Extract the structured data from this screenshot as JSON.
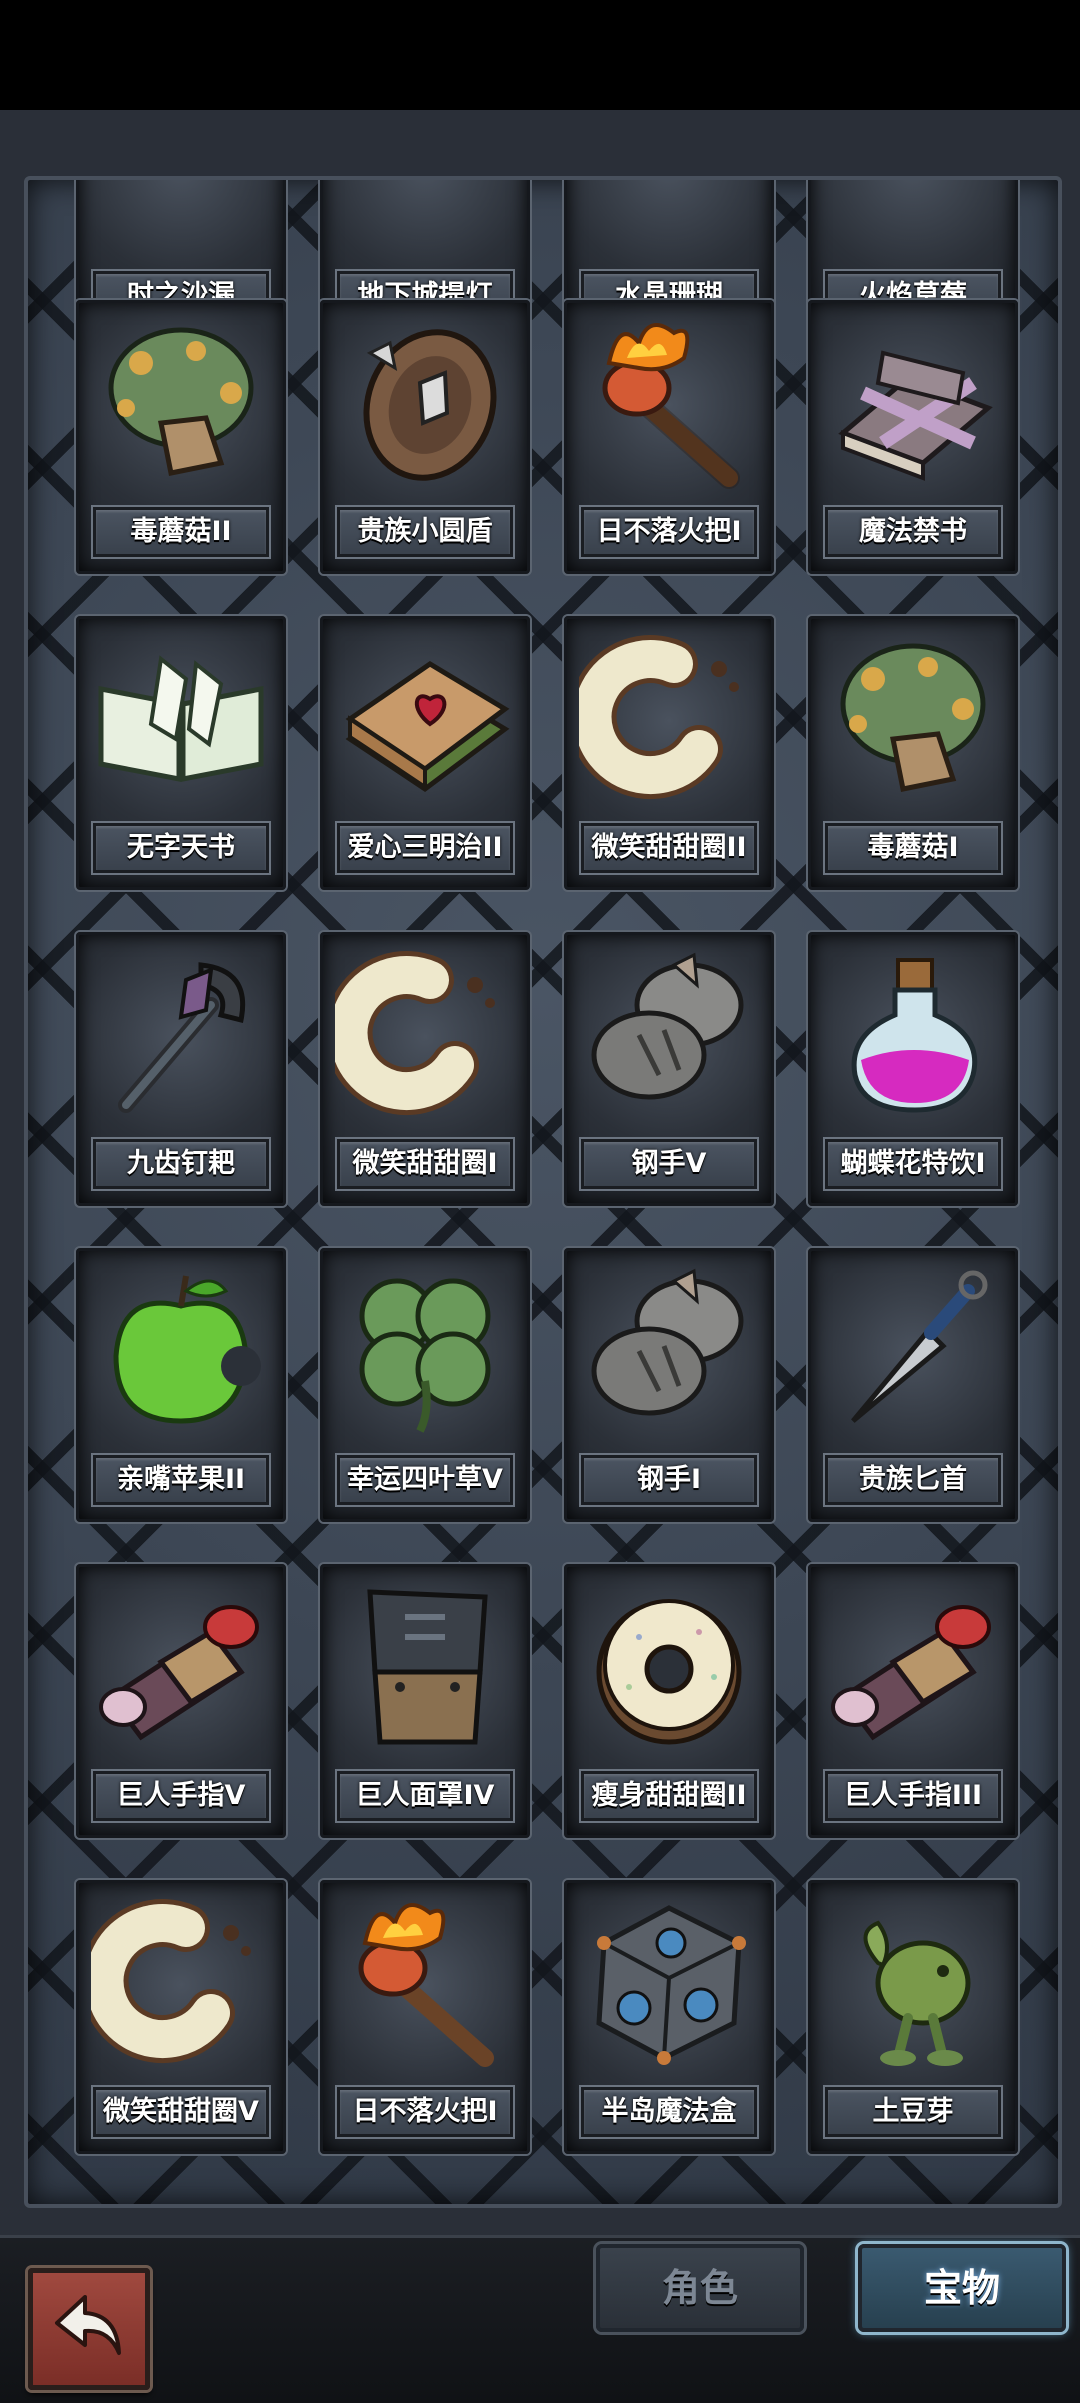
{
  "top_row": [
    "时之沙漏",
    "地下城提灯",
    "水晶珊瑚",
    "火焰草莓"
  ],
  "items": [
    {
      "label": "毒蘑菇II",
      "icon": "poison-mushroom-icon"
    },
    {
      "label": "贵族小圆盾",
      "icon": "round-shield-icon"
    },
    {
      "label": "日不落火把I",
      "icon": "torch-icon"
    },
    {
      "label": "魔法禁书",
      "icon": "forbidden-book-icon"
    },
    {
      "label": "无字天书",
      "icon": "blank-book-icon"
    },
    {
      "label": "爱心三明治II",
      "icon": "heart-sandwich-icon"
    },
    {
      "label": "微笑甜甜圈II",
      "icon": "smile-donut-icon"
    },
    {
      "label": "毒蘑菇I",
      "icon": "poison-mushroom-icon"
    },
    {
      "label": "九齿钉耙",
      "icon": "rake-icon"
    },
    {
      "label": "微笑甜甜圈I",
      "icon": "smile-donut-icon"
    },
    {
      "label": "钢手V",
      "icon": "steel-gauntlet-icon"
    },
    {
      "label": "蝴蝶花特饮I",
      "icon": "potion-bottle-icon"
    },
    {
      "label": "亲嘴苹果II",
      "icon": "bitten-apple-icon"
    },
    {
      "label": "幸运四叶草V",
      "icon": "four-leaf-clover-icon"
    },
    {
      "label": "钢手I",
      "icon": "steel-gauntlet-icon"
    },
    {
      "label": "贵族匕首",
      "icon": "dagger-icon"
    },
    {
      "label": "巨人手指V",
      "icon": "giant-finger-icon"
    },
    {
      "label": "巨人面罩IV",
      "icon": "giant-mask-icon"
    },
    {
      "label": "瘦身甜甜圈II",
      "icon": "sprinkle-donut-icon"
    },
    {
      "label": "巨人手指III",
      "icon": "giant-finger-icon"
    },
    {
      "label": "微笑甜甜圈V",
      "icon": "smile-donut-icon"
    },
    {
      "label": "日不落火把I",
      "icon": "torch-icon"
    },
    {
      "label": "半岛魔法盒",
      "icon": "magic-cube-icon"
    },
    {
      "label": "土豆芽",
      "icon": "potato-sprout-icon"
    }
  ],
  "tabs": {
    "role": "角色",
    "treasure": "宝物"
  },
  "back_icon": "back-arrow-icon",
  "colors": {
    "panel": "#36404d",
    "active_tab": "#3a5a70",
    "back_button": "#a0493f"
  }
}
